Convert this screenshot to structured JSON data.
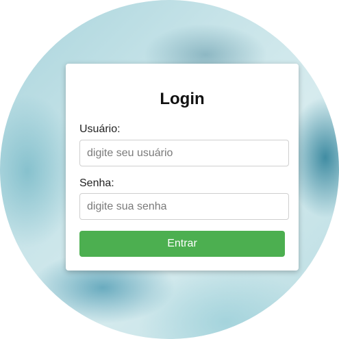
{
  "login": {
    "title": "Login",
    "username_label": "Usuário:",
    "username_placeholder": "digite seu usuário",
    "username_value": "",
    "password_label": "Senha:",
    "password_placeholder": "digite sua senha",
    "password_value": "",
    "submit_label": "Entrar"
  },
  "colors": {
    "button": "#4caf50",
    "background": "#c6e3e8"
  }
}
